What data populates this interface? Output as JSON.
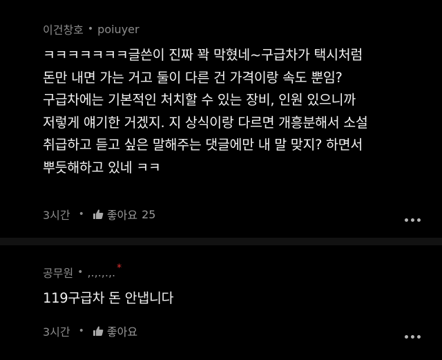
{
  "comments": [
    {
      "author": "이건창호",
      "separator": "•",
      "handle": "poiuyer",
      "text": "ㅋㅋㅋㅋㅋㅋㅋ글쓴이 진짜 꽉 막혔네~구급차가 택시처럼\n돈만 내면 가는 거고  둘이 다른 건 가격이랑 속도 뿐임?\n구급차에는 기본적인 처치할 수 있는 장비, 인원 있으니까\n저렇게 얘기한 거겠지. 지 상식이랑 다르면 개흥분해서 소설\n취급하고 듣고 싶은 말해주는 댓글에만 내 말 맞지? 하면서\n뿌듯해하고 있네 ㅋㅋ",
      "time": "3시간",
      "dot": "•",
      "like_label": "좋아요",
      "like_count": "25"
    },
    {
      "author": "공무원",
      "separator": "•",
      "handle": ",.,.,.,.",
      "mark": "*",
      "text": "119구급차 돈 안냅니다",
      "time": "3시간",
      "dot": "•",
      "like_label": "좋아요"
    }
  ],
  "icons": {
    "like": "thumbs-up-icon",
    "more": "more-options-icon"
  },
  "colors": {
    "background": "#000000",
    "divider": "#121212",
    "meta_text": "#8d8d8d",
    "body_text": "#f2f2f2",
    "mark": "#e03030"
  }
}
